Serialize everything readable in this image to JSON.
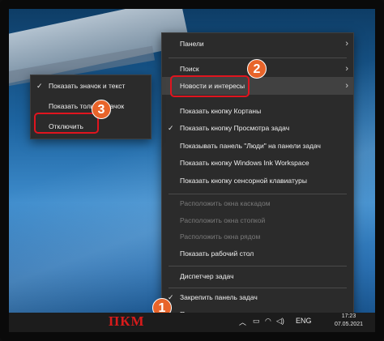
{
  "main_menu": {
    "items": [
      {
        "label": "Панели",
        "chevron": true
      },
      {
        "label": "Поиск",
        "chevron": true
      },
      {
        "label": "Новости и интересы",
        "chevron": true
      },
      {
        "label": "Показать кнопку Кортаны"
      },
      {
        "label": "Показать кнопку Просмотра задач",
        "checked": true
      },
      {
        "label": "Показывать панель \"Люди\" на панели задач"
      },
      {
        "label": "Показать кнопку Windows Ink Workspace"
      },
      {
        "label": "Показать кнопку сенсорной клавиатуры"
      },
      {
        "label": "Расположить окна каскадом",
        "disabled": true
      },
      {
        "label": "Расположить окна стопкой",
        "disabled": true
      },
      {
        "label": "Расположить окна рядом",
        "disabled": true
      },
      {
        "label": "Показать рабочий стол"
      },
      {
        "label": "Диспетчер задач"
      },
      {
        "label": "Закрепить панель задач",
        "checked": true
      },
      {
        "label": "Параметры панели задач"
      }
    ]
  },
  "sub_menu": {
    "items": [
      {
        "label": "Показать значок и текст",
        "checked": true
      },
      {
        "label": "Показать только значок"
      },
      {
        "label": "Отключить"
      }
    ]
  },
  "badges": [
    "1",
    "2",
    "3"
  ],
  "taskbar": {
    "caption": "ПКМ",
    "language": "ENG",
    "time": "17:23",
    "date": "07.05.2021"
  },
  "colors": {
    "menu_bg": "#2b2b2b",
    "highlight": "#e0141e",
    "badge": "#e8642a",
    "caption": "#d81b1b"
  }
}
